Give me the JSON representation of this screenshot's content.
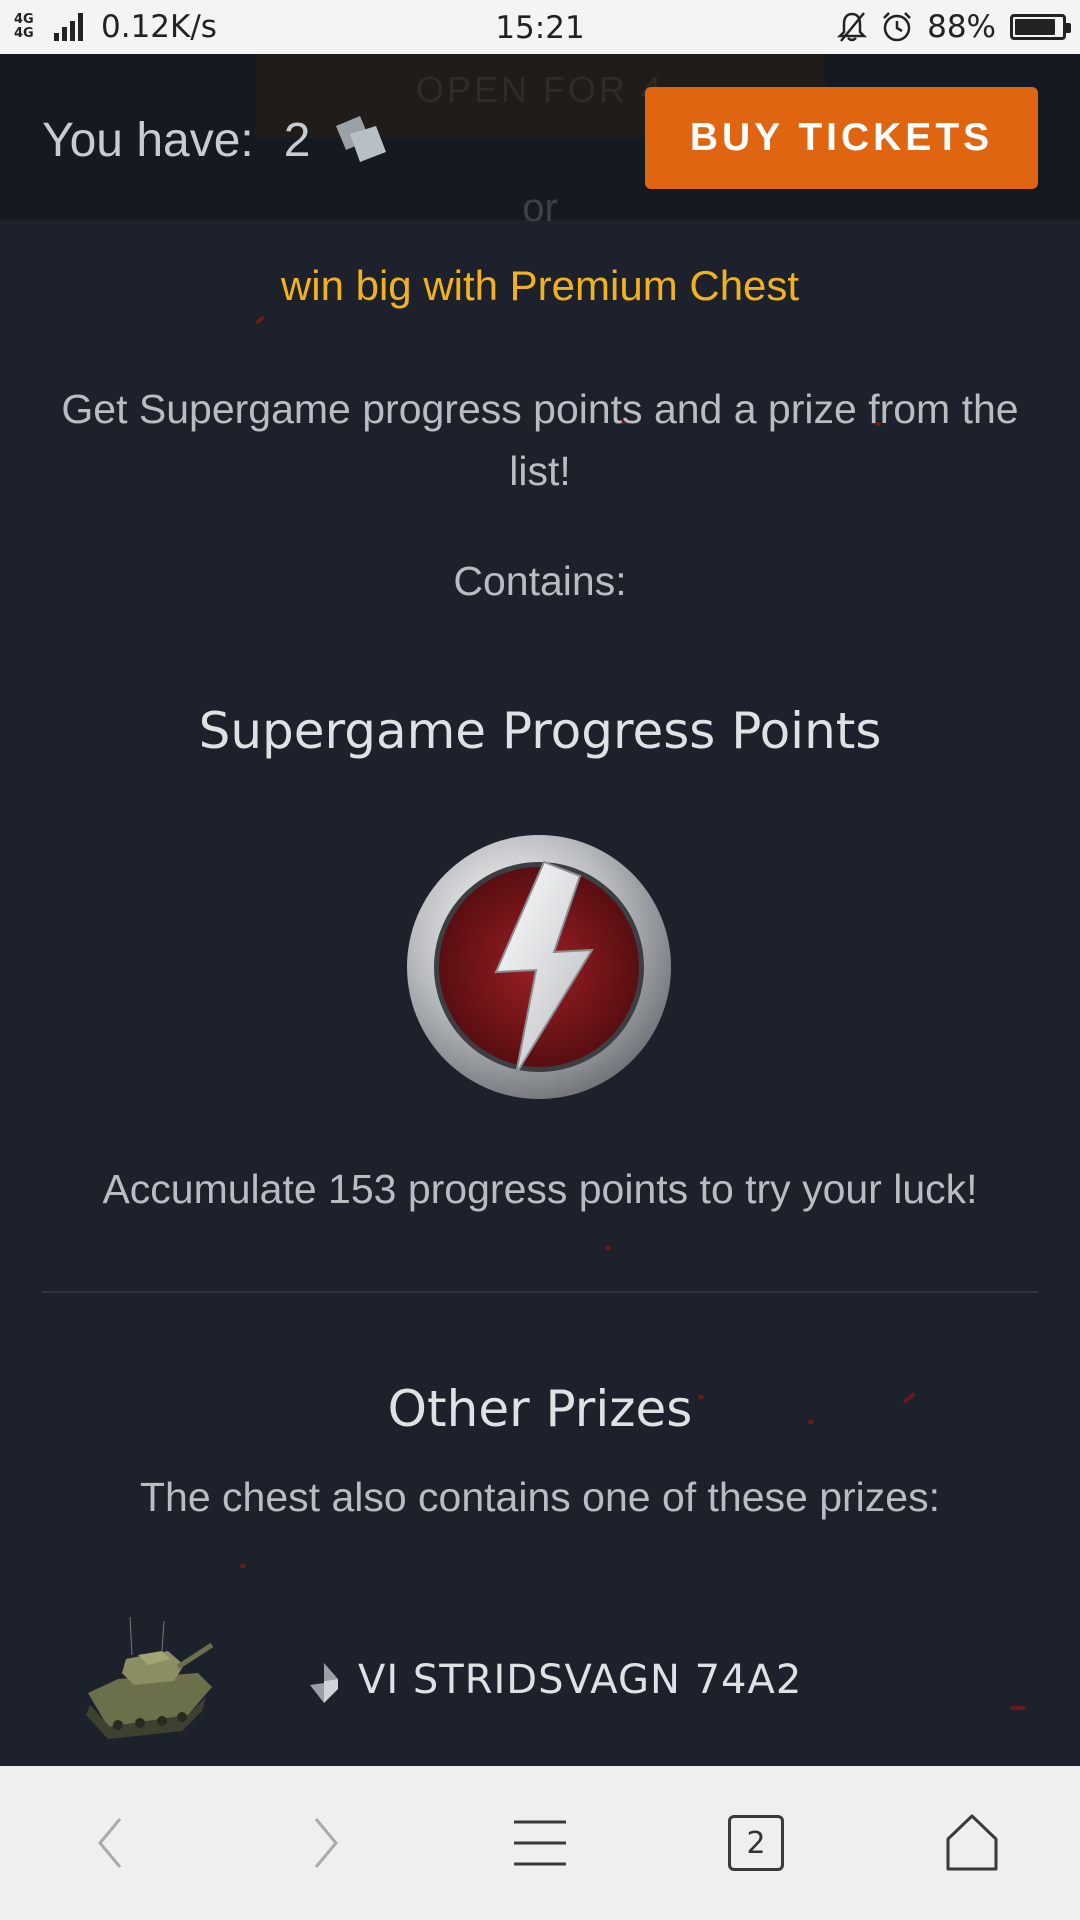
{
  "status_bar": {
    "network": "4G 4G",
    "speed": "0.12K/s",
    "time": "15:21",
    "battery": "88%",
    "battery_level": 0.88
  },
  "header": {
    "ghost_button": "OPEN FOR 4",
    "you_have_label": "You have:",
    "ticket_count": "2",
    "buy_button": "BUY TICKETS",
    "or": "or"
  },
  "premium": {
    "link": "win big with Premium Chest",
    "description": "Get Supergame progress points and a prize from the list!",
    "contains": "Contains:"
  },
  "supergame": {
    "title": "Supergame Progress Points",
    "badge_icon": "lightning-badge-icon",
    "accumulate": "Accumulate 153 progress points to try your luck!"
  },
  "other_prizes": {
    "title": "Other Prizes",
    "description": "The chest also contains one of these prizes:",
    "items": [
      {
        "tier": "VI",
        "name": "VI STRIDSVAGN 74A2",
        "icon": "tank-icon"
      }
    ]
  },
  "nav": {
    "tabs_count": "2"
  },
  "colors": {
    "background": "#1c212c",
    "accent_orange": "#e06510",
    "link_yellow": "#f2b21e"
  }
}
